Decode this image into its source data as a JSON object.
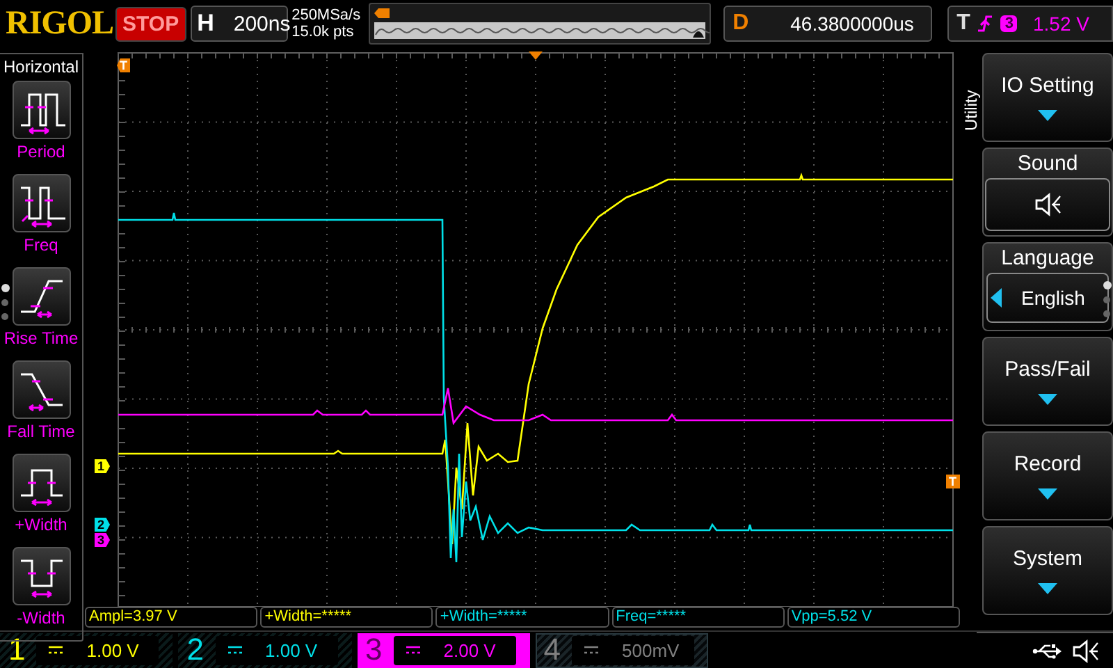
{
  "top_bar": {
    "logo": "RIGOL",
    "run_state": "STOP",
    "timebase_label": "H",
    "timebase": "200ns",
    "sample_rate": "250MSa/s",
    "memory_depth": "15.0k pts",
    "delay_label": "D",
    "delay": "46.3800000us",
    "trigger_label": "T",
    "trigger_source": "3",
    "trigger_level": "1.52 V"
  },
  "left_menu": {
    "title": "Horizontal",
    "items": [
      {
        "kind": "period",
        "label": "Period"
      },
      {
        "kind": "freq",
        "label": "Freq"
      },
      {
        "kind": "rise",
        "label": "Rise Time"
      },
      {
        "kind": "fall",
        "label": "Fall Time"
      },
      {
        "kind": "pwidth",
        "label": "+Width"
      },
      {
        "kind": "nwidth",
        "label": "-Width"
      }
    ],
    "pages": [
      {
        "selected": true
      },
      {
        "selected": false
      },
      {
        "selected": false
      }
    ]
  },
  "markers": [
    {
      "kind": "trigger",
      "text": "T"
    },
    {
      "kind": "channel",
      "text": "1",
      "color": "#ffff00"
    },
    {
      "kind": "channel",
      "text": "2",
      "color": "#00e0e8"
    },
    {
      "kind": "channel",
      "text": "3",
      "color": "#ff00ff"
    },
    {
      "kind": "trigger",
      "text": "T"
    }
  ],
  "measurements": [
    {
      "text": "Ampl=3.97 V",
      "color": "#ffff00"
    },
    {
      "text": "+Width=*****",
      "color": "#ffff00"
    },
    {
      "text": "+Width=*****",
      "color": "#00e0e8"
    },
    {
      "text": "Freq=*****",
      "color": "#00e0e8"
    },
    {
      "text": "Vpp=5.52 V",
      "color": "#00e0e8"
    }
  ],
  "right_menu": {
    "title": "Utility",
    "items": [
      {
        "kind": "submenu",
        "label": "IO Setting"
      },
      {
        "kind": "icon",
        "label": "Sound"
      },
      {
        "kind": "option",
        "label": "Language",
        "value": "English"
      },
      {
        "kind": "submenu",
        "label": "Pass/Fail"
      },
      {
        "kind": "submenu",
        "label": "Record"
      },
      {
        "kind": "submenu",
        "label": "System"
      }
    ],
    "pages": [
      {
        "selected": true
      },
      {
        "selected": false
      },
      {
        "selected": false
      }
    ]
  },
  "channels": [
    {
      "number": "1",
      "scale": "1.00 V",
      "color": "#ffff00",
      "on": true,
      "selected": false
    },
    {
      "number": "2",
      "scale": "1.00 V",
      "color": "#00e0e8",
      "on": true,
      "selected": false
    },
    {
      "number": "3",
      "scale": "2.00 V",
      "color": "#ff00ff",
      "on": true,
      "selected": true
    },
    {
      "number": "4",
      "scale": "500mV",
      "color": "#808080",
      "on": false,
      "selected": false
    }
  ]
}
